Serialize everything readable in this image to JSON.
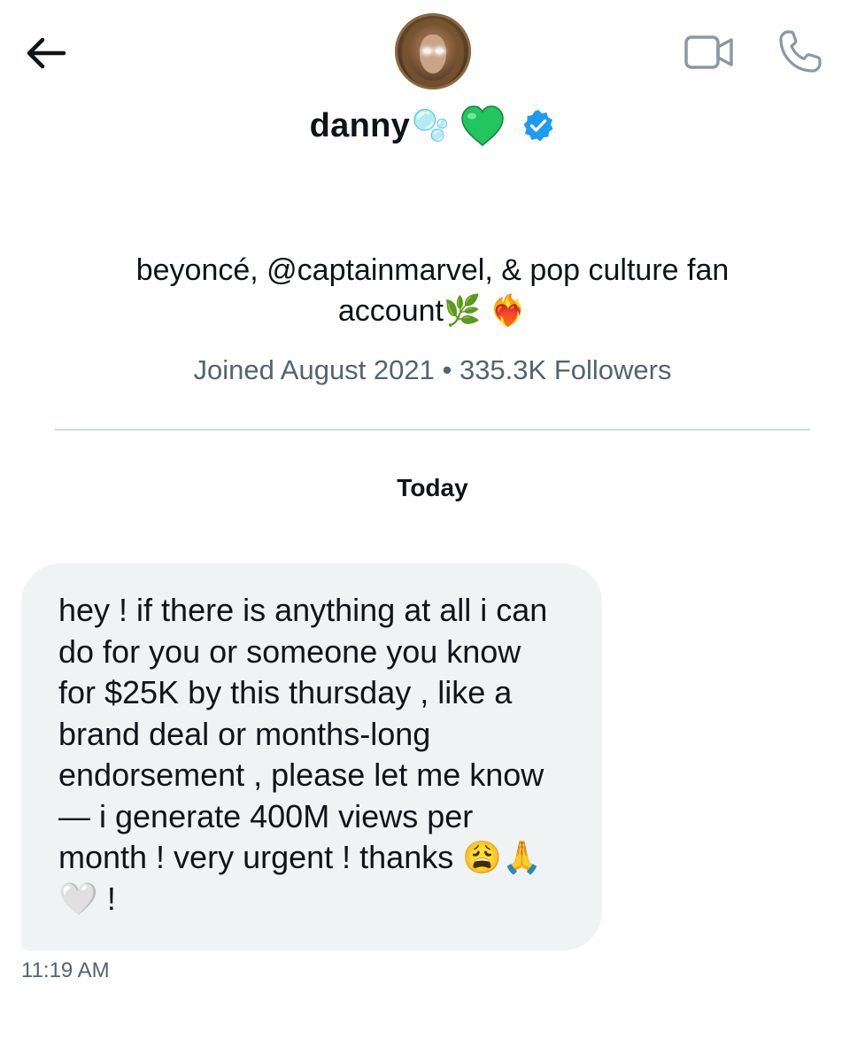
{
  "header": {
    "back_icon": "arrow-left-icon",
    "video_icon": "video-camera-icon",
    "call_icon": "phone-icon"
  },
  "profile": {
    "avatar_icon": "profile-avatar",
    "display_name": "danny",
    "name_emoji": "🫧",
    "heart_emoji": "💚",
    "verified_icon": "verified-badge-icon",
    "verified_color": "#1d9bf0",
    "bio": "beyoncé, @captainmarvel, & pop culture fan account🌿 ❤️‍🔥",
    "meta": "Joined August 2021 • 335.3K Followers"
  },
  "conversation": {
    "day_label": "Today",
    "messages": [
      {
        "text": "hey ! if there is anything at all i can do for you or someone you know for $25K by this thursday , like a brand deal or months-long endorsement , please let me know — i generate 400M views per month ! very urgent ! thanks 😩🙏🤍 !",
        "time": "11:19 AM"
      }
    ]
  },
  "colors": {
    "text_primary": "#0f1419",
    "text_secondary": "#536471",
    "bubble_bg": "#eff3f4",
    "divider": "#cfd9de",
    "heart": "#22c55e"
  }
}
